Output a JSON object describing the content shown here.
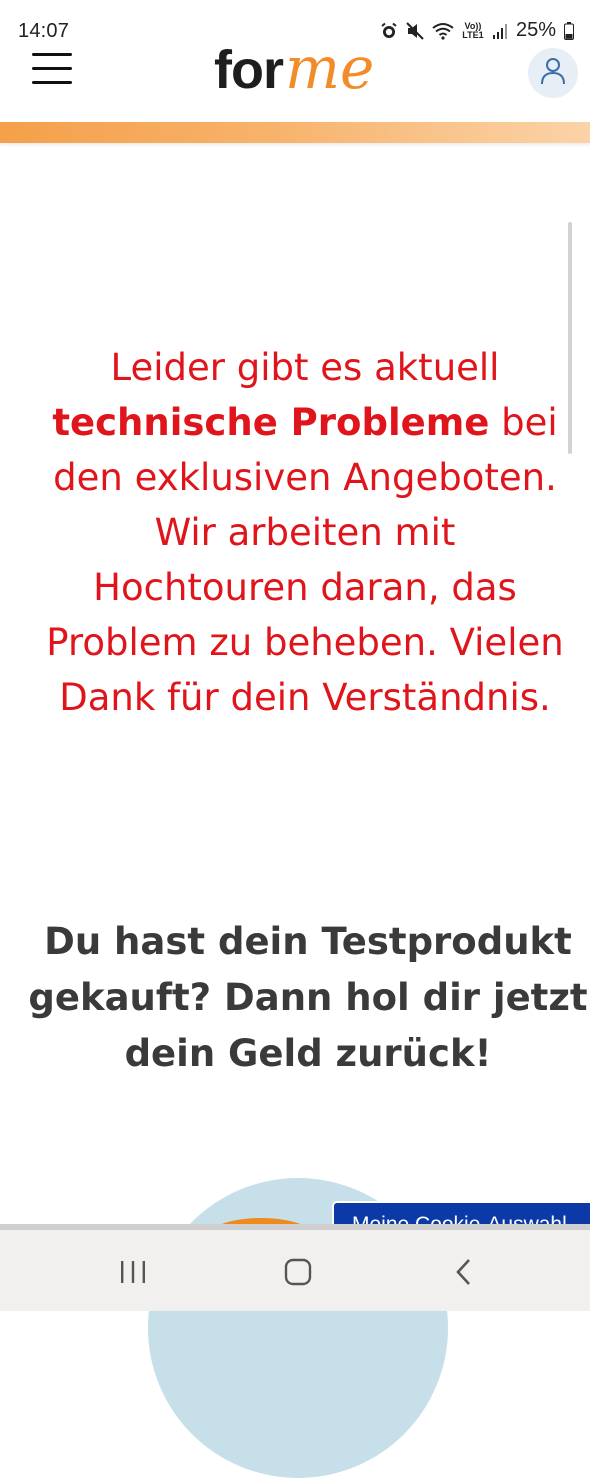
{
  "status_bar": {
    "time": "14:07",
    "battery_percent": "25%",
    "icons": [
      "alarm-icon",
      "mute-icon",
      "wifi-icon",
      "volte-icon",
      "signal-icon",
      "battery-icon"
    ],
    "volte_label": "Vo)) LTE1"
  },
  "header": {
    "logo_part1": "for",
    "logo_part2": "me",
    "menu_icon": "hamburger-menu-icon",
    "account_icon": "user-account-icon",
    "accent_color": "#f28c28"
  },
  "notice": {
    "line1": "Leider gibt es aktuell",
    "bold_text": "technische Probleme",
    "line2_rest": " bei",
    "line3": "den exklusiven Angeboten.",
    "line4": "Wir arbeiten mit",
    "line5": "Hochtouren daran, das",
    "line6": "Problem zu beheben. Vielen",
    "line7": "Dank für dein Verständnis.",
    "color": "#e0141b"
  },
  "headline": {
    "line1": "Du hast dein Testprodukt",
    "line2": "gekauft? Dann hol dir jetzt",
    "line3": "dein Geld zurück!"
  },
  "cookie_button": {
    "label": "Meine Cookie-Auswahl",
    "color": "#0b3aa8"
  },
  "nav_bar": {
    "buttons": [
      "recent-apps-icon",
      "home-icon",
      "back-icon"
    ]
  }
}
